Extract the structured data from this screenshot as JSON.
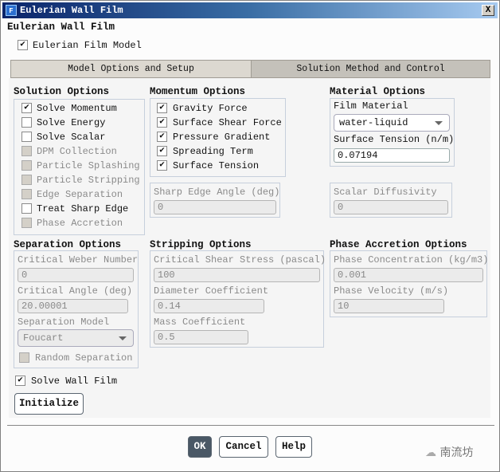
{
  "window": {
    "title": "Eulerian Wall Film",
    "icon_letter": "F",
    "close": "X"
  },
  "heading": "Eulerian Wall Film",
  "film_model": {
    "label": "Eulerian Film Model",
    "checked": true
  },
  "tabs": [
    {
      "label": "Model Options and Setup",
      "active": true
    },
    {
      "label": "Solution Method and Control",
      "active": false
    }
  ],
  "solution_options": {
    "title": "Solution Options",
    "items": [
      {
        "label": "Solve Momentum",
        "checked": true,
        "enabled": true
      },
      {
        "label": "Solve Energy",
        "checked": false,
        "enabled": true
      },
      {
        "label": "Solve Scalar",
        "checked": false,
        "enabled": true
      },
      {
        "label": "DPM Collection",
        "checked": false,
        "enabled": false
      },
      {
        "label": "Particle Splashing",
        "checked": false,
        "enabled": false
      },
      {
        "label": "Particle Stripping",
        "checked": false,
        "enabled": false
      },
      {
        "label": "Edge Separation",
        "checked": false,
        "enabled": false
      },
      {
        "label": "Treat Sharp Edge",
        "checked": false,
        "enabled": true
      },
      {
        "label": "Phase Accretion",
        "checked": false,
        "enabled": false
      }
    ]
  },
  "momentum_options": {
    "title": "Momentum Options",
    "items": [
      {
        "label": "Gravity Force",
        "checked": true
      },
      {
        "label": "Surface Shear Force",
        "checked": true
      },
      {
        "label": "Pressure Gradient",
        "checked": true
      },
      {
        "label": "Spreading Term",
        "checked": true
      },
      {
        "label": "Surface Tension",
        "checked": true
      }
    ],
    "sharp_edge_angle": {
      "label": "Sharp Edge Angle (deg)",
      "value": "0"
    }
  },
  "material_options": {
    "title": "Material Options",
    "film_material_label": "Film Material",
    "film_material": "water-liquid",
    "surface_tension_label": "Surface Tension (n/m)",
    "surface_tension": "0.07194",
    "scalar_diffusivity_label": "Scalar Diffusivity",
    "scalar_diffusivity": "0"
  },
  "separation_options": {
    "title": "Separation Options",
    "weber_label": "Critical Weber Number",
    "weber": "0",
    "angle_label": "Critical Angle (deg)",
    "angle": "20.00001",
    "model_label": "Separation Model",
    "model": "Foucart",
    "random_label": "Random Separation"
  },
  "stripping_options": {
    "title": "Stripping Options",
    "shear_label": "Critical Shear Stress (pascal)",
    "shear": "100",
    "diameter_label": "Diameter Coefficient",
    "diameter": "0.14",
    "mass_label": "Mass Coefficient",
    "mass": "0.5"
  },
  "phase_accretion_options": {
    "title": "Phase Accretion Options",
    "conc_label": "Phase Concentration (kg/m3)",
    "conc": "0.001",
    "vel_label": "Phase Velocity (m/s)",
    "vel": "10"
  },
  "solve_wall_film": {
    "label": "Solve Wall Film",
    "checked": true
  },
  "buttons": {
    "initialize": "Initialize",
    "ok": "OK",
    "cancel": "Cancel",
    "help": "Help"
  },
  "watermark": "南流坊"
}
